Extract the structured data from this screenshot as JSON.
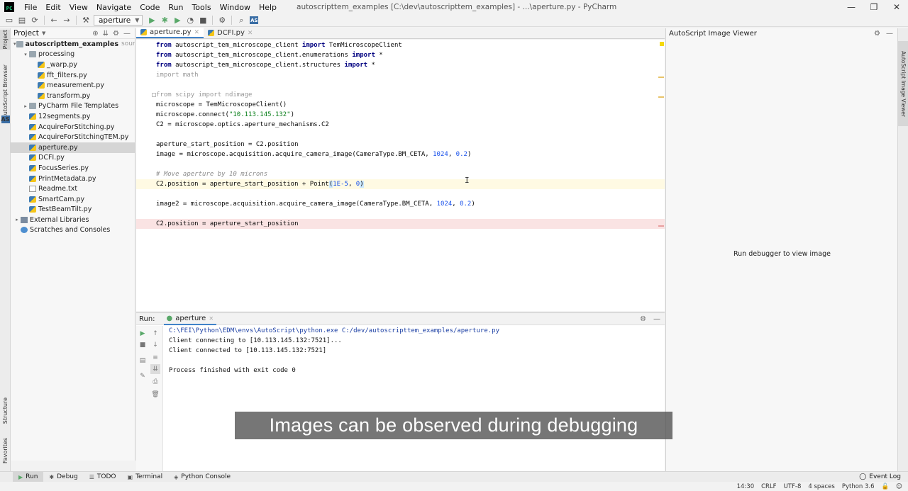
{
  "window": {
    "title": "autoscripttem_examples [C:\\dev\\autoscripttem_examples] - ...\\aperture.py - PyCharm",
    "menu": [
      "File",
      "Edit",
      "View",
      "Navigate",
      "Code",
      "Run",
      "Tools",
      "Window",
      "Help"
    ]
  },
  "toolbar": {
    "run_config": "aperture",
    "as_badge": "AS"
  },
  "left_stripe": {
    "project": "Project",
    "autoscript_browser": "AutoScript Browser",
    "as_badge": "AS",
    "structure": "Structure",
    "favorites": "Favorites"
  },
  "project": {
    "header": "Project",
    "tree": [
      {
        "label": "autoscripttem_examples",
        "note": "sources roo",
        "indent": 0,
        "arrow": "▾",
        "icon": "folder",
        "bold": true
      },
      {
        "label": "processing",
        "indent": 1,
        "arrow": "▾",
        "icon": "folder"
      },
      {
        "label": "_warp.py",
        "indent": 2,
        "arrow": "",
        "icon": "py"
      },
      {
        "label": "fft_filters.py",
        "indent": 2,
        "arrow": "",
        "icon": "py"
      },
      {
        "label": "measurement.py",
        "indent": 2,
        "arrow": "",
        "icon": "py"
      },
      {
        "label": "transform.py",
        "indent": 2,
        "arrow": "",
        "icon": "py"
      },
      {
        "label": "PyCharm File Templates",
        "indent": 1,
        "arrow": "▸",
        "icon": "folder"
      },
      {
        "label": "12segments.py",
        "indent": 1,
        "arrow": "",
        "icon": "py"
      },
      {
        "label": "AcquireForStitching.py",
        "indent": 1,
        "arrow": "",
        "icon": "py"
      },
      {
        "label": "AcquireForStitchingTEM.py",
        "indent": 1,
        "arrow": "",
        "icon": "py"
      },
      {
        "label": "aperture.py",
        "indent": 1,
        "arrow": "",
        "icon": "py",
        "selected": true
      },
      {
        "label": "DCFI.py",
        "indent": 1,
        "arrow": "",
        "icon": "py"
      },
      {
        "label": "FocusSeries.py",
        "indent": 1,
        "arrow": "",
        "icon": "py"
      },
      {
        "label": "PrintMetadata.py",
        "indent": 1,
        "arrow": "",
        "icon": "py"
      },
      {
        "label": "Readme.txt",
        "indent": 1,
        "arrow": "",
        "icon": "txt"
      },
      {
        "label": "SmartCam.py",
        "indent": 1,
        "arrow": "",
        "icon": "py"
      },
      {
        "label": "TestBeamTilt.py",
        "indent": 1,
        "arrow": "",
        "icon": "py"
      },
      {
        "label": "External Libraries",
        "indent": 0,
        "arrow": "▸",
        "icon": "lib"
      },
      {
        "label": "Scratches and Consoles",
        "indent": 0,
        "arrow": "",
        "icon": "scratch"
      }
    ]
  },
  "editor": {
    "tabs": [
      {
        "label": "aperture.py",
        "active": true
      },
      {
        "label": "DCFI.py",
        "active": false
      }
    ],
    "lines": [
      "from autoscript_tem_microscope_client import TemMicroscopeClient",
      "from autoscript_tem_microscope_client.enumerations import *",
      "from autoscript_tem_microscope_client.structures import *",
      "import math",
      "",
      "from scipy import ndimage",
      "microscope = TemMicroscopeClient()",
      "microscope.connect(\"10.113.145.132\")",
      "C2 = microscope.optics.aperture_mechanisms.C2",
      "",
      "aperture_start_position = C2.position",
      "image = microscope.acquisition.acquire_camera_image(CameraType.BM_CETA, 1024, 0.2)",
      "",
      "# Move aperture by 10 microns",
      "C2.position = aperture_start_position + Point(1E-5, 0)",
      "",
      "image2 = microscope.acquisition.acquire_camera_image(CameraType.BM_CETA, 1024, 0.2)",
      "",
      "C2.position = aperture_start_position"
    ]
  },
  "viewer": {
    "title": "AutoScript Image Viewer",
    "message": "Run debugger to view image",
    "stripe_label": "AutoScript Image Viewer"
  },
  "run": {
    "label": "Run:",
    "tab": "aperture",
    "output": [
      "C:\\FEI\\Python\\EDM\\envs\\AutoScript\\python.exe C:/dev/autoscripttem_examples/aperture.py",
      "Client connecting to [10.113.145.132:7521]...",
      "Client connected to [10.113.145.132:7521]",
      "",
      "Process finished with exit code 0"
    ]
  },
  "subtitle": "Images can be observed during debugging",
  "bottom_tabs": [
    "Run",
    "Debug",
    "TODO",
    "Terminal",
    "Python Console"
  ],
  "event_log": "Event Log",
  "status": {
    "position": "14:30",
    "line_sep": "CRLF",
    "encoding": "UTF-8",
    "indent": "4 spaces",
    "interpreter": "Python 3.6"
  }
}
